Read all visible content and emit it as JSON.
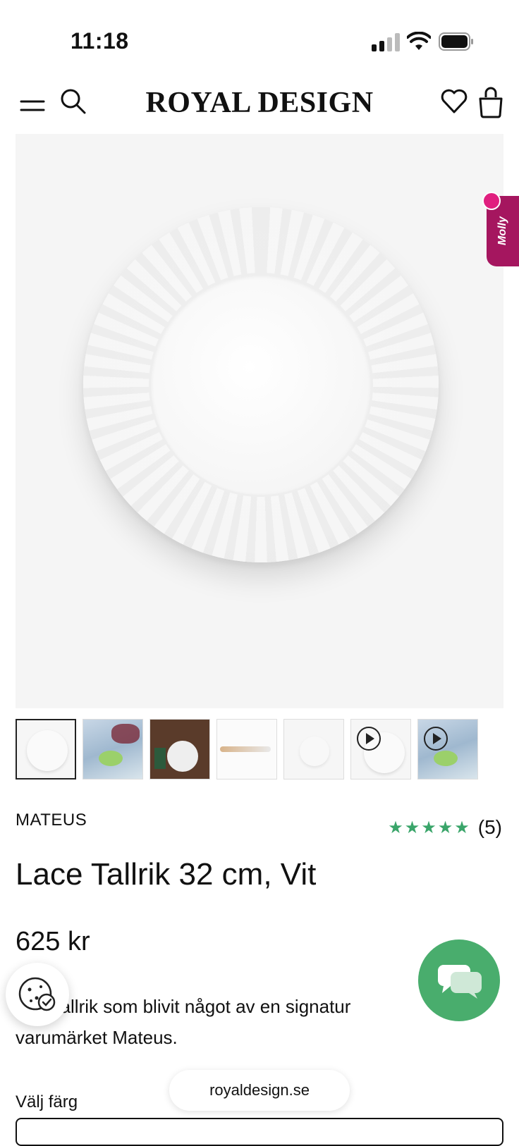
{
  "status_bar": {
    "time": "11:18"
  },
  "header": {
    "brand": "ROYAL DESIGN",
    "icons": [
      "menu-icon",
      "search-icon",
      "heart-icon",
      "shopping-bag-icon"
    ]
  },
  "side_tab": {
    "label": "Molly"
  },
  "gallery": {
    "thumbnails": [
      {
        "kind": "image",
        "active": true
      },
      {
        "kind": "image"
      },
      {
        "kind": "image"
      },
      {
        "kind": "image"
      },
      {
        "kind": "image"
      },
      {
        "kind": "video"
      },
      {
        "kind": "video"
      }
    ]
  },
  "product": {
    "brand": "MATEUS",
    "rating_stars": "★★★★★",
    "rating_value": 5,
    "review_count": "(5)",
    "title": "Lace Tallrik 32 cm, Vit",
    "price": "625 kr",
    "description": "cker tallrik som blivit något av en signatur varumärket Mateus."
  },
  "options": {
    "color_label": "Välj färg"
  },
  "browser": {
    "url": "royaldesign.se"
  },
  "colors": {
    "accent_green": "#49ad6d",
    "star_green": "#3aa56a",
    "molly_purple": "#a5165f"
  }
}
